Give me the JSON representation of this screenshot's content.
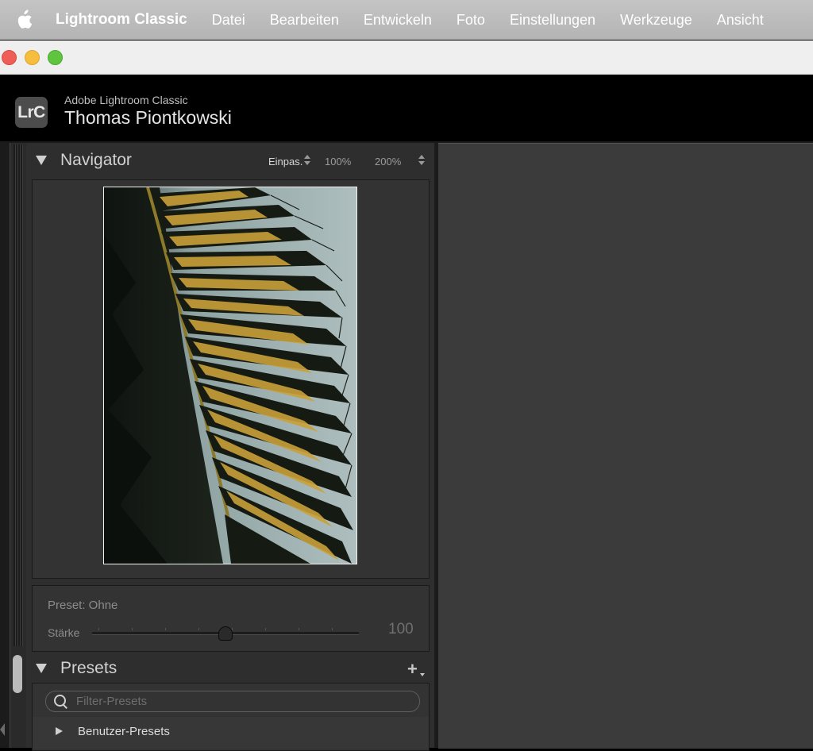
{
  "menubar": {
    "app_name": "Lightroom Classic",
    "items": [
      "Datei",
      "Bearbeiten",
      "Entwickeln",
      "Foto",
      "Einstellungen",
      "Werkzeuge",
      "Ansicht"
    ]
  },
  "identity": {
    "logo_text": "LrC",
    "product": "Adobe Lightroom Classic",
    "user": "Thomas Piontkowski"
  },
  "navigator": {
    "title": "Navigator",
    "zoom_fit": "Einpas.",
    "zoom_100": "100%",
    "zoom_200": "200%"
  },
  "preset_amount": {
    "label": "Preset: Ohne",
    "strength_label": "Stärke",
    "strength_value": "100"
  },
  "presets": {
    "title": "Presets",
    "search_placeholder": "Filter-Presets",
    "groups": [
      "Benutzer-Presets"
    ]
  },
  "colors": {
    "panel_bg": "#2e2e2e",
    "main_bg": "#3b3b3b",
    "menubar_bg": "#b8b8b8",
    "close": "#ee5e57",
    "minimize": "#f6bd3f",
    "zoom": "#5fc53f"
  }
}
